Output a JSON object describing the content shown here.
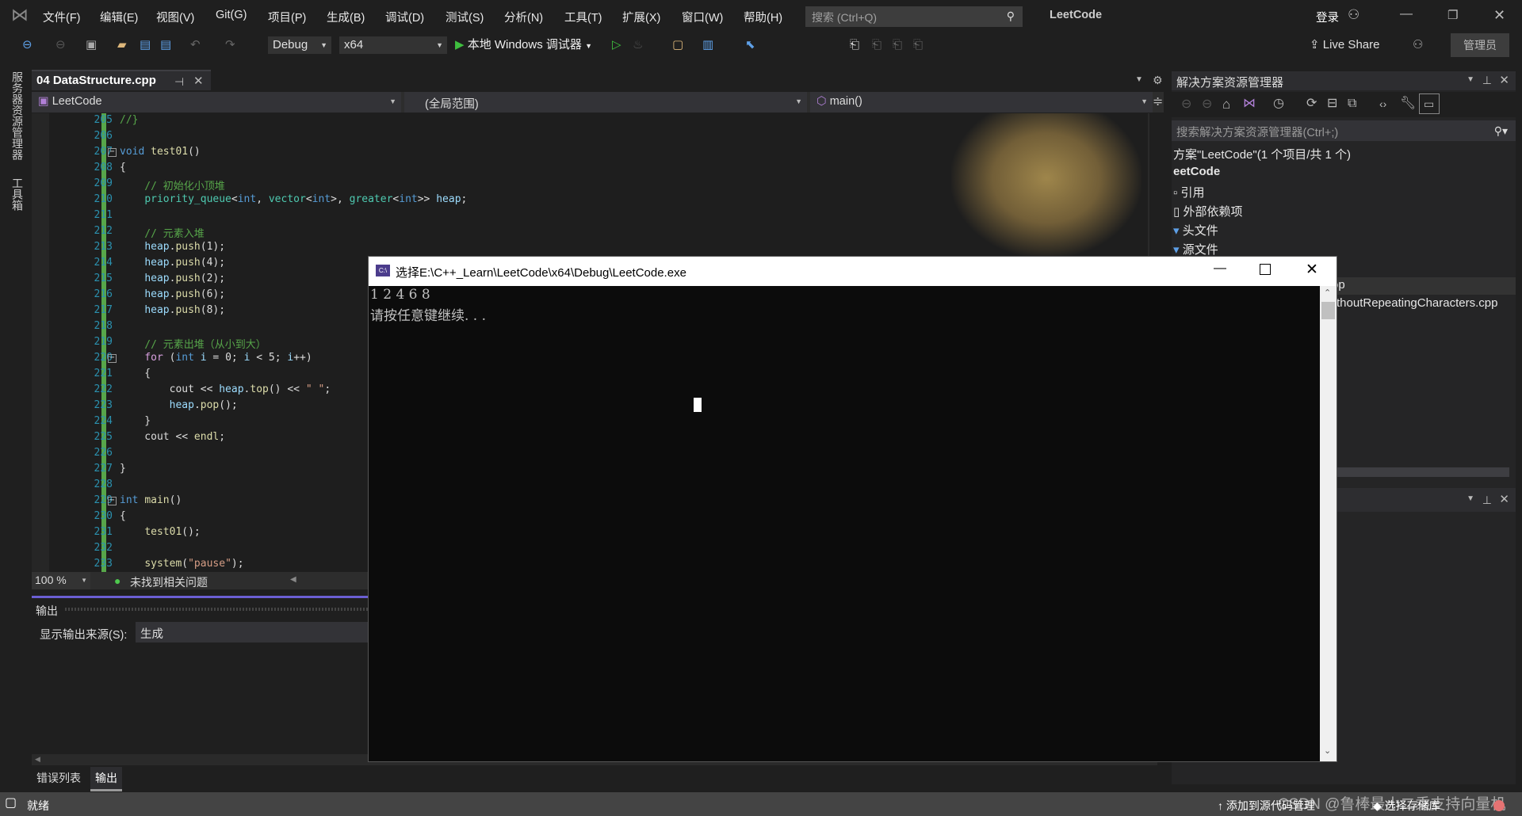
{
  "menu": {
    "items": [
      "文件(F)",
      "编辑(E)",
      "视图(V)",
      "Git(G)",
      "项目(P)",
      "生成(B)",
      "调试(D)",
      "测试(S)",
      "分析(N)",
      "工具(T)",
      "扩展(X)",
      "窗口(W)",
      "帮助(H)"
    ],
    "search_placeholder": "搜索 (Ctrl+Q)",
    "solution_name": "LeetCode",
    "login": "登录"
  },
  "toolbar": {
    "config": "Debug",
    "platform": "x64",
    "start_label": "本地 Windows 调试器",
    "live_share": "Live Share",
    "admin": "管理员"
  },
  "left_strip": {
    "tabs": [
      "服务器资源管理器",
      "工具箱"
    ]
  },
  "editor": {
    "tab_title": "04 DataStructure.cpp",
    "nav_project": "LeetCode",
    "nav_scope": "(全局范围)",
    "nav_member": "main()",
    "zoom": "100 %",
    "issues": "未找到相关问题",
    "lines": [
      {
        "n": "205",
        "tokens": [
          [
            "//}",
            "com"
          ]
        ]
      },
      {
        "n": "206",
        "tokens": []
      },
      {
        "n": "207",
        "tokens": [
          [
            "void",
            "kw"
          ],
          [
            " ",
            "txt"
          ],
          [
            "test01",
            "fn"
          ],
          [
            "()",
            "txt"
          ]
        ]
      },
      {
        "n": "208",
        "tokens": [
          [
            "{",
            "txt"
          ]
        ]
      },
      {
        "n": "209",
        "tokens": [
          [
            "    // 初始化小顶堆",
            "com"
          ]
        ]
      },
      {
        "n": "210",
        "tokens": [
          [
            "    ",
            "txt"
          ],
          [
            "priority_queue",
            "ty"
          ],
          [
            "<",
            "txt"
          ],
          [
            "int",
            "kw"
          ],
          [
            ", ",
            "txt"
          ],
          [
            "vector",
            "ty"
          ],
          [
            "<",
            "txt"
          ],
          [
            "int",
            "kw"
          ],
          [
            ">, ",
            "txt"
          ],
          [
            "greater",
            "ty"
          ],
          [
            "<",
            "txt"
          ],
          [
            "int",
            "kw"
          ],
          [
            ">> ",
            "txt"
          ],
          [
            "heap",
            "var"
          ],
          [
            ";",
            "txt"
          ]
        ]
      },
      {
        "n": "211",
        "tokens": []
      },
      {
        "n": "212",
        "tokens": [
          [
            "    // 元素入堆",
            "com"
          ]
        ]
      },
      {
        "n": "213",
        "tokens": [
          [
            "    ",
            "txt"
          ],
          [
            "heap",
            "var"
          ],
          [
            ".",
            "txt"
          ],
          [
            "push",
            "fn"
          ],
          [
            "(1);",
            "txt"
          ]
        ]
      },
      {
        "n": "214",
        "tokens": [
          [
            "    ",
            "txt"
          ],
          [
            "heap",
            "var"
          ],
          [
            ".",
            "txt"
          ],
          [
            "push",
            "fn"
          ],
          [
            "(4);",
            "txt"
          ]
        ]
      },
      {
        "n": "215",
        "tokens": [
          [
            "    ",
            "txt"
          ],
          [
            "heap",
            "var"
          ],
          [
            ".",
            "txt"
          ],
          [
            "push",
            "fn"
          ],
          [
            "(2);",
            "txt"
          ]
        ]
      },
      {
        "n": "216",
        "tokens": [
          [
            "    ",
            "txt"
          ],
          [
            "heap",
            "var"
          ],
          [
            ".",
            "txt"
          ],
          [
            "push",
            "fn"
          ],
          [
            "(6);",
            "txt"
          ]
        ]
      },
      {
        "n": "217",
        "tokens": [
          [
            "    ",
            "txt"
          ],
          [
            "heap",
            "var"
          ],
          [
            ".",
            "txt"
          ],
          [
            "push",
            "fn"
          ],
          [
            "(8);",
            "txt"
          ]
        ]
      },
      {
        "n": "218",
        "tokens": []
      },
      {
        "n": "219",
        "tokens": [
          [
            "    // 元素出堆（从小到大）",
            "com"
          ]
        ]
      },
      {
        "n": "220",
        "tokens": [
          [
            "    ",
            "txt"
          ],
          [
            "for",
            "ctl"
          ],
          [
            " (",
            "txt"
          ],
          [
            "int",
            "kw"
          ],
          [
            " ",
            "txt"
          ],
          [
            "i",
            "var"
          ],
          [
            " = 0; ",
            "txt"
          ],
          [
            "i",
            "var"
          ],
          [
            " < 5; ",
            "txt"
          ],
          [
            "i",
            "var"
          ],
          [
            "++)",
            "txt"
          ]
        ]
      },
      {
        "n": "221",
        "tokens": [
          [
            "    {",
            "txt"
          ]
        ]
      },
      {
        "n": "222",
        "tokens": [
          [
            "        cout << ",
            "txt"
          ],
          [
            "heap",
            "var"
          ],
          [
            ".",
            "txt"
          ],
          [
            "top",
            "fn"
          ],
          [
            "() << ",
            "txt"
          ],
          [
            "\" \"",
            "str"
          ],
          [
            ";",
            "txt"
          ]
        ]
      },
      {
        "n": "223",
        "tokens": [
          [
            "        ",
            "txt"
          ],
          [
            "heap",
            "var"
          ],
          [
            ".",
            "txt"
          ],
          [
            "pop",
            "fn"
          ],
          [
            "();",
            "txt"
          ]
        ]
      },
      {
        "n": "224",
        "tokens": [
          [
            "    }",
            "txt"
          ]
        ]
      },
      {
        "n": "225",
        "tokens": [
          [
            "    cout << ",
            "txt"
          ],
          [
            "endl",
            "fn"
          ],
          [
            ";",
            "txt"
          ]
        ]
      },
      {
        "n": "226",
        "tokens": []
      },
      {
        "n": "227",
        "tokens": [
          [
            "}",
            "txt"
          ]
        ]
      },
      {
        "n": "228",
        "tokens": []
      },
      {
        "n": "229",
        "tokens": [
          [
            "int",
            "kw"
          ],
          [
            " ",
            "txt"
          ],
          [
            "main",
            "fn"
          ],
          [
            "()",
            "txt"
          ]
        ]
      },
      {
        "n": "230",
        "tokens": [
          [
            "{",
            "txt"
          ]
        ]
      },
      {
        "n": "231",
        "tokens": [
          [
            "    ",
            "txt"
          ],
          [
            "test01",
            "fn"
          ],
          [
            "();",
            "txt"
          ]
        ]
      },
      {
        "n": "232",
        "tokens": []
      },
      {
        "n": "233",
        "tokens": [
          [
            "    ",
            "txt"
          ],
          [
            "system",
            "fn"
          ],
          [
            "(",
            "txt"
          ],
          [
            "\"pause\"",
            "str"
          ],
          [
            ");",
            "txt"
          ]
        ]
      }
    ]
  },
  "output": {
    "title": "输出",
    "source_label": "显示输出来源(S):",
    "source_value": "生成"
  },
  "bottom_tabs": [
    "错误列表",
    "输出"
  ],
  "status": {
    "ready": "就绪",
    "add_source_control": "添加到源代码管理",
    "select_repo": "选择存储库",
    "watermark": "CSDN @鲁棒最小二乘支持向量机"
  },
  "solution_explorer": {
    "title": "解决方案资源管理器",
    "search_placeholder": "搜索解决方案资源管理器(Ctrl+;)",
    "items": [
      "方案\"LeetCode\"(1 个项目/共 1 个)",
      "eetCode",
      "引用",
      "外部依赖项",
      "头文件",
      "源文件"
    ],
    "hidden_items": [
      "op",
      "thoutRepeatingCharacters.cpp"
    ]
  },
  "console": {
    "title": "选择E:\\C++_Learn\\LeetCode\\x64\\Debug\\LeetCode.exe",
    "line1": "1 2 4 6 8",
    "line2": "请按任意键继续. . ."
  },
  "colors": {
    "accent": "#6b5fd3",
    "change_bar": "#57a64a",
    "line_number": "#2b91af",
    "statusbar": "#444444"
  }
}
